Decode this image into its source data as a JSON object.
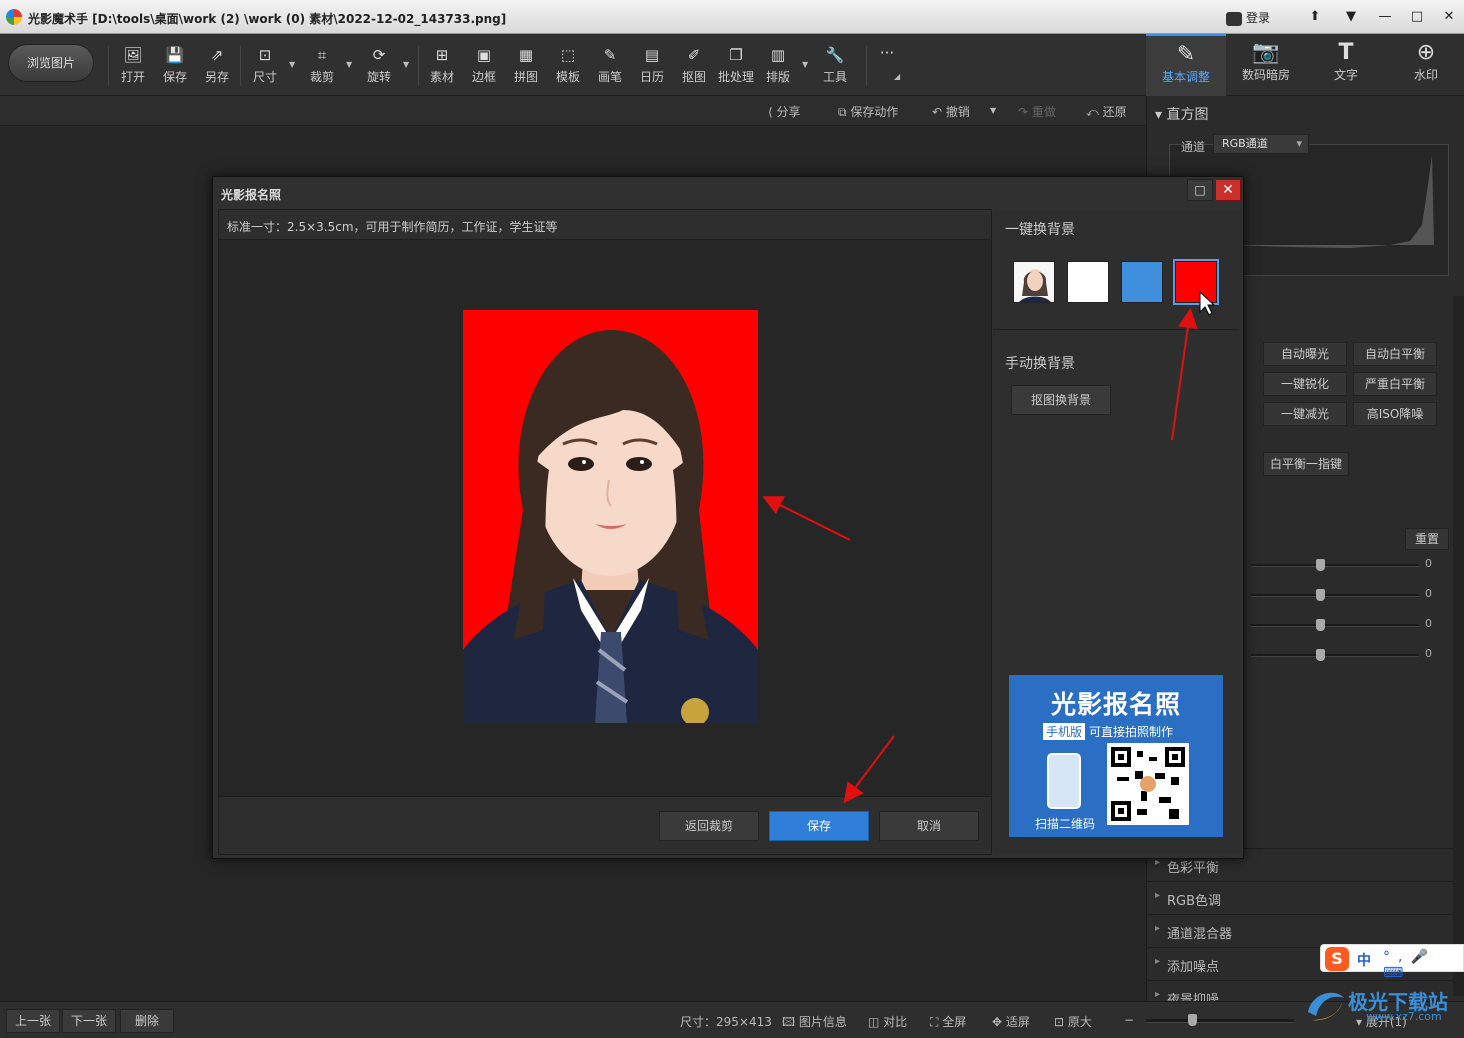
{
  "window": {
    "title": "光影魔术手 [D:\\tools\\桌面\\work (2) \\work (0) 素材\\2022-12-02_143733.png]",
    "login": "登录",
    "controls": [
      "⬆",
      "▼",
      "—",
      "□",
      "✕"
    ]
  },
  "toolbar": {
    "browse": "浏览图片",
    "tools": [
      "打开",
      "保存",
      "另存",
      "尺寸",
      "裁剪",
      "旋转",
      "素材",
      "边框",
      "拼图",
      "模板",
      "画笔",
      "日历",
      "抠图",
      "批处理",
      "排版",
      "工具"
    ],
    "more": "···"
  },
  "right_tabs": [
    "基本调整",
    "数码暗房",
    "文字",
    "水印"
  ],
  "secondary_bar": {
    "share": "分享",
    "save_action": "保存动作",
    "undo": "撤销",
    "redo": "重做",
    "restore": "还原"
  },
  "right_panel": {
    "histogram_header": "直方图",
    "channel_label": "通道",
    "channel_value": "RGB通道",
    "buttons": [
      "自动曝光",
      "自动白平衡",
      "一键锐化",
      "严重白平衡",
      "一键减光",
      "高ISO降噪"
    ],
    "wb_button": "白平衡一指键",
    "reset": "重置",
    "slider_values": [
      "0",
      "0",
      "0",
      "0"
    ],
    "sections": [
      "色彩平衡",
      "RGB色调",
      "通道混合器",
      "添加噪点",
      "夜景抑噪"
    ]
  },
  "dialog": {
    "title": "光影报名照",
    "info": "标准一寸：2.5×3.5cm，可用于制作简历，工作证，学生证等",
    "one_click_bg": "一键换背景",
    "manual_bg": "手动换背景",
    "matte_button": "抠图换背景",
    "swatch_colors": [
      "#ffffff",
      "#3f8fdc",
      "#ff0000"
    ],
    "back_button": "返回裁剪",
    "save_button": "保存",
    "cancel_button": "取消",
    "photo_bg_color": "#ff0000",
    "promo": {
      "title": "光影报名照",
      "tag": "手机版",
      "subtitle": "可直接拍照制作",
      "scan": "扫描二维码"
    }
  },
  "statusbar": {
    "prev": "上一张",
    "next": "下一张",
    "delete": "删除",
    "size": "尺寸：295×413",
    "info": "图片信息",
    "compare": "对比",
    "fullscreen": "全屏",
    "fit": "适屏",
    "original": "原大",
    "expand": "展开(1)"
  },
  "watermark": {
    "text": "极光下载站",
    "url": "www.xz7.com"
  },
  "ime": {
    "s": "S",
    "mode": "中"
  }
}
